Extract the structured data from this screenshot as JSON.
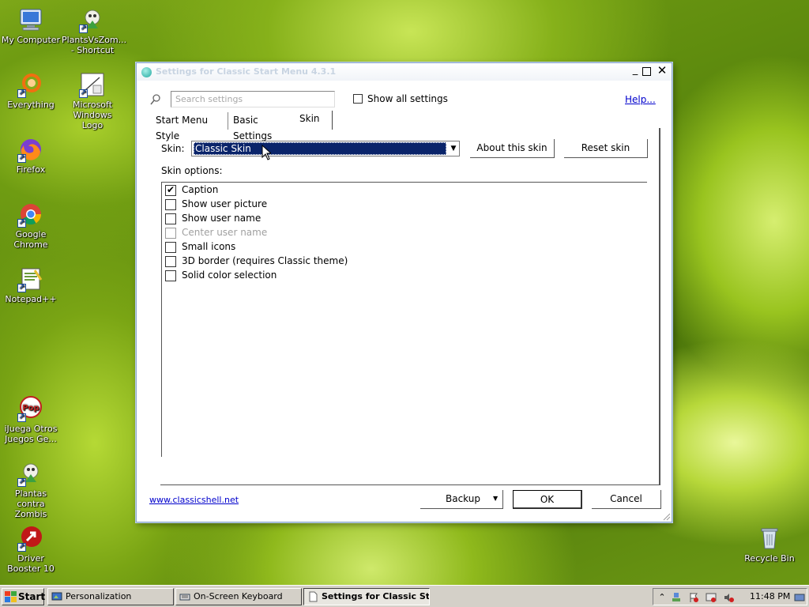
{
  "desktop_icons": [
    {
      "label": "My Computer",
      "icon": "my-computer-icon"
    },
    {
      "label": "PlantsVsZom... - Shortcut",
      "icon": "plants-vs-zombies-icon"
    },
    {
      "label": "Everything",
      "icon": "everything-search-icon"
    },
    {
      "label": "Microsoft Windows Logo",
      "icon": "windows-logo-icon"
    },
    {
      "label": "Firefox",
      "icon": "firefox-icon"
    },
    {
      "label": "Google Chrome",
      "icon": "chrome-icon"
    },
    {
      "label": "Notepad++",
      "icon": "notepad-plus-icon"
    },
    {
      "label": "iJuega Otros Juegos Ge...",
      "icon": "popcap-games-icon"
    },
    {
      "label": "Plantas contra Zombis",
      "icon": "plantas-contra-zombis-icon"
    },
    {
      "label": "Driver Booster 10",
      "icon": "driver-booster-icon"
    },
    {
      "label": "Recycle Bin",
      "icon": "recycle-bin-icon"
    }
  ],
  "window": {
    "title": "Settings for Classic Start Menu 4.3.1",
    "search_placeholder": "Search settings",
    "show_all_label": "Show all settings",
    "show_all_checked": false,
    "help_link": "Help...",
    "tabs": [
      {
        "label": "Start Menu Style",
        "active": false
      },
      {
        "label": "Basic Settings",
        "active": false
      },
      {
        "label": "Skin",
        "active": true
      }
    ],
    "skin_label": "Skin:",
    "skin_value": "Classic Skin",
    "about_skin_button": "About this skin",
    "reset_skin_button": "Reset skin",
    "skin_options_label": "Skin options:",
    "options": [
      {
        "label": "Caption",
        "checked": true,
        "enabled": true
      },
      {
        "label": "Show user picture",
        "checked": false,
        "enabled": true
      },
      {
        "label": "Show user name",
        "checked": false,
        "enabled": true
      },
      {
        "label": "Center user name",
        "checked": false,
        "enabled": false
      },
      {
        "label": "Small icons",
        "checked": false,
        "enabled": true
      },
      {
        "label": "3D border (requires Classic theme)",
        "checked": false,
        "enabled": true
      },
      {
        "label": "Solid color selection",
        "checked": false,
        "enabled": true
      }
    ],
    "website_link": "www.classicshell.net",
    "backup_button": "Backup",
    "ok_button": "OK",
    "cancel_button": "Cancel"
  },
  "taskbar": {
    "start_label": "Start",
    "tasks": [
      {
        "label": "Personalization",
        "active": false
      },
      {
        "label": "On-Screen Keyboard",
        "active": false
      },
      {
        "label": "Settings for Classic St...",
        "active": true
      }
    ],
    "clock": "11:48 PM"
  },
  "colors": {
    "selection_bg": "#0a246a",
    "link": "#0000cc",
    "taskbar": "#d4d0c8"
  }
}
